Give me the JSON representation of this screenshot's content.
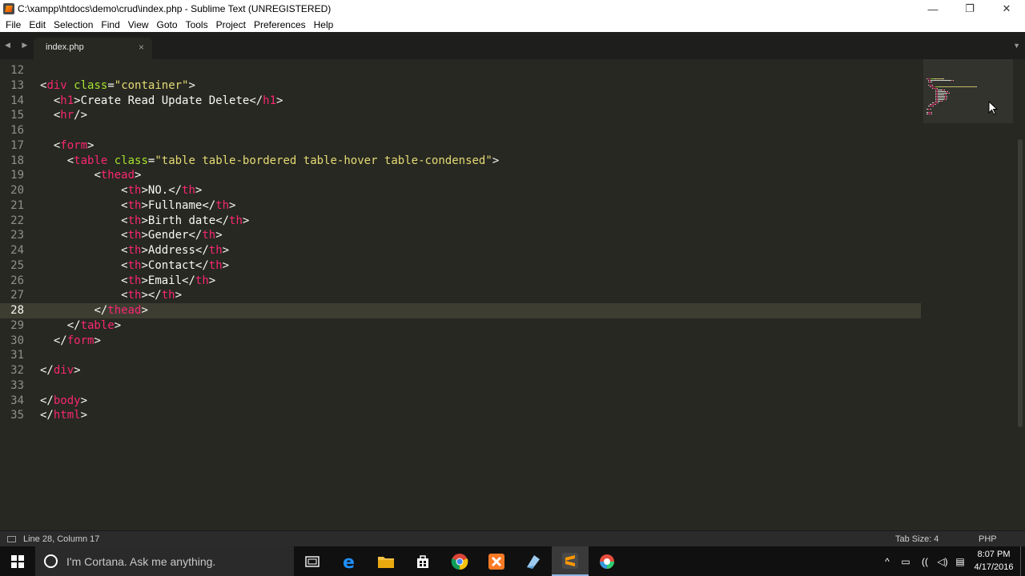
{
  "window": {
    "title": "C:\\xampp\\htdocs\\demo\\crud\\index.php - Sublime Text (UNREGISTERED)",
    "minimize": "—",
    "restore": "❐",
    "close": "✕"
  },
  "menu": [
    "File",
    "Edit",
    "Selection",
    "Find",
    "View",
    "Goto",
    "Tools",
    "Project",
    "Preferences",
    "Help"
  ],
  "tabs": [
    {
      "label": "index.php",
      "close": "×"
    }
  ],
  "tab_nav": {
    "arrows": "◀ ▶",
    "dropdown": "▼"
  },
  "editor": {
    "current_line": 28,
    "lines": [
      {
        "n": "12",
        "tokens": []
      },
      {
        "n": "13",
        "tokens": [
          [
            "pun",
            "<"
          ],
          [
            "tag",
            "div"
          ],
          [
            "txt",
            " "
          ],
          [
            "attr",
            "class"
          ],
          [
            "pun",
            "="
          ],
          [
            "str",
            "\"container\""
          ],
          [
            "pun",
            ">"
          ]
        ]
      },
      {
        "n": "14",
        "tokens": [
          [
            "txt",
            "  "
          ],
          [
            "pun",
            "<"
          ],
          [
            "tag",
            "h1"
          ],
          [
            "pun",
            ">"
          ],
          [
            "txt",
            "Create Read Update Delete"
          ],
          [
            "pun",
            "</"
          ],
          [
            "tag",
            "h1"
          ],
          [
            "pun",
            ">"
          ]
        ]
      },
      {
        "n": "15",
        "tokens": [
          [
            "txt",
            "  "
          ],
          [
            "pun",
            "<"
          ],
          [
            "tag",
            "hr"
          ],
          [
            "pun",
            "/>"
          ]
        ]
      },
      {
        "n": "16",
        "tokens": []
      },
      {
        "n": "17",
        "tokens": [
          [
            "txt",
            "  "
          ],
          [
            "pun",
            "<"
          ],
          [
            "tag",
            "form"
          ],
          [
            "pun",
            ">"
          ]
        ]
      },
      {
        "n": "18",
        "tokens": [
          [
            "txt",
            "    "
          ],
          [
            "pun",
            "<"
          ],
          [
            "tag",
            "table"
          ],
          [
            "txt",
            " "
          ],
          [
            "attr",
            "class"
          ],
          [
            "pun",
            "="
          ],
          [
            "str",
            "\"table table-bordered table-hover table-condensed\""
          ],
          [
            "pun",
            ">"
          ]
        ]
      },
      {
        "n": "19",
        "tokens": [
          [
            "txt",
            "        "
          ],
          [
            "pun",
            "<"
          ],
          [
            "tag",
            "thead"
          ],
          [
            "pun",
            ">"
          ]
        ]
      },
      {
        "n": "20",
        "tokens": [
          [
            "txt",
            "            "
          ],
          [
            "pun",
            "<"
          ],
          [
            "tag",
            "th"
          ],
          [
            "pun",
            ">"
          ],
          [
            "txt",
            "NO."
          ],
          [
            "pun",
            "</"
          ],
          [
            "tag",
            "th"
          ],
          [
            "pun",
            ">"
          ]
        ]
      },
      {
        "n": "21",
        "tokens": [
          [
            "txt",
            "            "
          ],
          [
            "pun",
            "<"
          ],
          [
            "tag",
            "th"
          ],
          [
            "pun",
            ">"
          ],
          [
            "txt",
            "Fullname"
          ],
          [
            "pun",
            "</"
          ],
          [
            "tag",
            "th"
          ],
          [
            "pun",
            ">"
          ]
        ]
      },
      {
        "n": "22",
        "tokens": [
          [
            "txt",
            "            "
          ],
          [
            "pun",
            "<"
          ],
          [
            "tag",
            "th"
          ],
          [
            "pun",
            ">"
          ],
          [
            "txt",
            "Birth date"
          ],
          [
            "pun",
            "</"
          ],
          [
            "tag",
            "th"
          ],
          [
            "pun",
            ">"
          ]
        ]
      },
      {
        "n": "23",
        "tokens": [
          [
            "txt",
            "            "
          ],
          [
            "pun",
            "<"
          ],
          [
            "tag",
            "th"
          ],
          [
            "pun",
            ">"
          ],
          [
            "txt",
            "Gender"
          ],
          [
            "pun",
            "</"
          ],
          [
            "tag",
            "th"
          ],
          [
            "pun",
            ">"
          ]
        ]
      },
      {
        "n": "24",
        "tokens": [
          [
            "txt",
            "            "
          ],
          [
            "pun",
            "<"
          ],
          [
            "tag",
            "th"
          ],
          [
            "pun",
            ">"
          ],
          [
            "txt",
            "Address"
          ],
          [
            "pun",
            "</"
          ],
          [
            "tag",
            "th"
          ],
          [
            "pun",
            ">"
          ]
        ]
      },
      {
        "n": "25",
        "tokens": [
          [
            "txt",
            "            "
          ],
          [
            "pun",
            "<"
          ],
          [
            "tag",
            "th"
          ],
          [
            "pun",
            ">"
          ],
          [
            "txt",
            "Contact"
          ],
          [
            "pun",
            "</"
          ],
          [
            "tag",
            "th"
          ],
          [
            "pun",
            ">"
          ]
        ]
      },
      {
        "n": "26",
        "tokens": [
          [
            "txt",
            "            "
          ],
          [
            "pun",
            "<"
          ],
          [
            "tag",
            "th"
          ],
          [
            "pun",
            ">"
          ],
          [
            "txt",
            "Email"
          ],
          [
            "pun",
            "</"
          ],
          [
            "tag",
            "th"
          ],
          [
            "pun",
            ">"
          ]
        ]
      },
      {
        "n": "27",
        "tokens": [
          [
            "txt",
            "            "
          ],
          [
            "pun",
            "<"
          ],
          [
            "tag",
            "th"
          ],
          [
            "pun",
            "></"
          ],
          [
            "tag",
            "th"
          ],
          [
            "pun",
            ">"
          ]
        ]
      },
      {
        "n": "28",
        "tokens": [
          [
            "txt",
            "        "
          ],
          [
            "pun",
            "</"
          ],
          [
            "tag",
            "thead"
          ],
          [
            "pun",
            ">"
          ]
        ]
      },
      {
        "n": "29",
        "tokens": [
          [
            "txt",
            "    "
          ],
          [
            "pun",
            "</"
          ],
          [
            "tag",
            "table"
          ],
          [
            "pun",
            ">"
          ]
        ]
      },
      {
        "n": "30",
        "tokens": [
          [
            "txt",
            "  "
          ],
          [
            "pun",
            "</"
          ],
          [
            "tag",
            "form"
          ],
          [
            "pun",
            ">"
          ]
        ]
      },
      {
        "n": "31",
        "tokens": []
      },
      {
        "n": "32",
        "tokens": [
          [
            "pun",
            "</"
          ],
          [
            "tag",
            "div"
          ],
          [
            "pun",
            ">"
          ]
        ]
      },
      {
        "n": "33",
        "tokens": []
      },
      {
        "n": "34",
        "tokens": [
          [
            "pun",
            "</"
          ],
          [
            "tag",
            "body"
          ],
          [
            "pun",
            ">"
          ]
        ]
      },
      {
        "n": "35",
        "tokens": [
          [
            "pun",
            "</"
          ],
          [
            "tag",
            "html"
          ],
          [
            "pun",
            ">"
          ]
        ]
      }
    ]
  },
  "status": {
    "position": "Line 28, Column 17",
    "tab_size": "Tab Size: 4",
    "syntax": "PHP"
  },
  "taskbar": {
    "cortana_placeholder": "I'm Cortana. Ask me anything.",
    "apps": [
      {
        "name": "task-view-icon",
        "glyph": "▭"
      },
      {
        "name": "edge-icon",
        "glyph": "e"
      },
      {
        "name": "file-explorer-icon",
        "glyph": "▬"
      },
      {
        "name": "store-icon",
        "glyph": "◼"
      },
      {
        "name": "chrome-icon",
        "glyph": "●"
      },
      {
        "name": "xampp-icon",
        "glyph": "✕"
      },
      {
        "name": "app-icon",
        "glyph": "◢"
      },
      {
        "name": "sublime-icon",
        "glyph": "S"
      },
      {
        "name": "color-picker-icon",
        "glyph": "◉"
      }
    ],
    "tray": [
      "^",
      "▭",
      "((",
      "◁)",
      "▤"
    ],
    "time": "8:07 PM",
    "date": "4/17/2016"
  },
  "colors": {
    "background": "#272822",
    "tag": "#f92672",
    "attribute": "#a6e22e",
    "string": "#e6db74",
    "text": "#f8f8f2",
    "line_number": "#8f908a"
  }
}
